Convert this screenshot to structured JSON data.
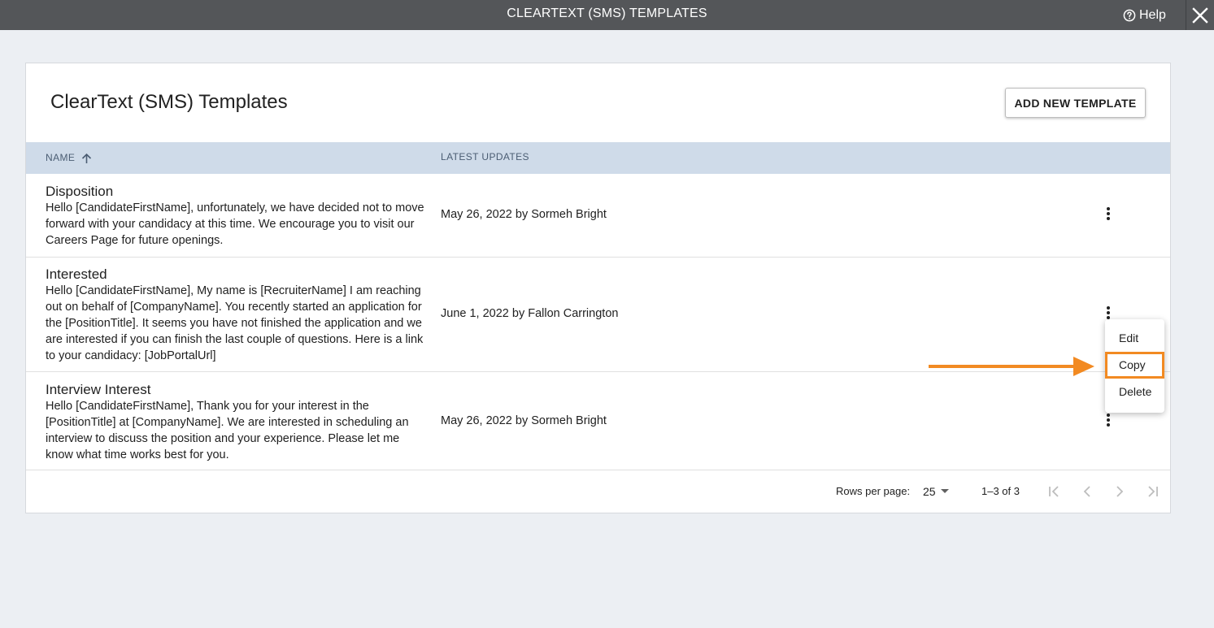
{
  "window": {
    "title": "CLEARTEXT (SMS) TEMPLATES",
    "help_label": "Help"
  },
  "page": {
    "title": "ClearText (SMS) Templates",
    "add_button": "ADD NEW TEMPLATE"
  },
  "table": {
    "columns": {
      "name": "NAME",
      "latest_updates": "LATEST UPDATES"
    },
    "sort": {
      "column": "name",
      "direction": "ascending"
    },
    "rows": [
      {
        "name": "Disposition",
        "body": "Hello [CandidateFirstName], unfortunately, we have decided not to move forward with your candidacy at this time. We encourage you to visit our Careers Page for future openings.",
        "updated": "May 26, 2022 by Sormeh Bright"
      },
      {
        "name": "Interested",
        "body": "Hello [CandidateFirstName], My name is [RecruiterName] I am reaching out on behalf of [CompanyName]. You recently started an application for the [PositionTitle]. It seems you have not finished the application and we are interested if you can finish the last couple of questions. Here is a link to your candidacy: [JobPortalUrl]",
        "updated": "June 1, 2022 by Fallon Carrington"
      },
      {
        "name": "Interview Interest",
        "body": "Hello [CandidateFirstName], Thank you for your interest in the [PositionTitle] at [CompanyName]. We are interested in scheduling an interview to discuss the position and your experience. Please let me know what time works best for you.",
        "updated": "May 26, 2022 by Sormeh Bright"
      }
    ]
  },
  "pagination": {
    "rows_per_page_label": "Rows per page:",
    "rows_per_page_value": "25",
    "range": "1–3 of 3"
  },
  "context_menu": {
    "items": [
      "Edit",
      "Copy",
      "Delete"
    ],
    "highlighted": "Copy"
  },
  "colors": {
    "topbar": "#545659",
    "header_row": "#cfdbe9",
    "highlight": "#f28a22",
    "background": "#eceff3"
  }
}
